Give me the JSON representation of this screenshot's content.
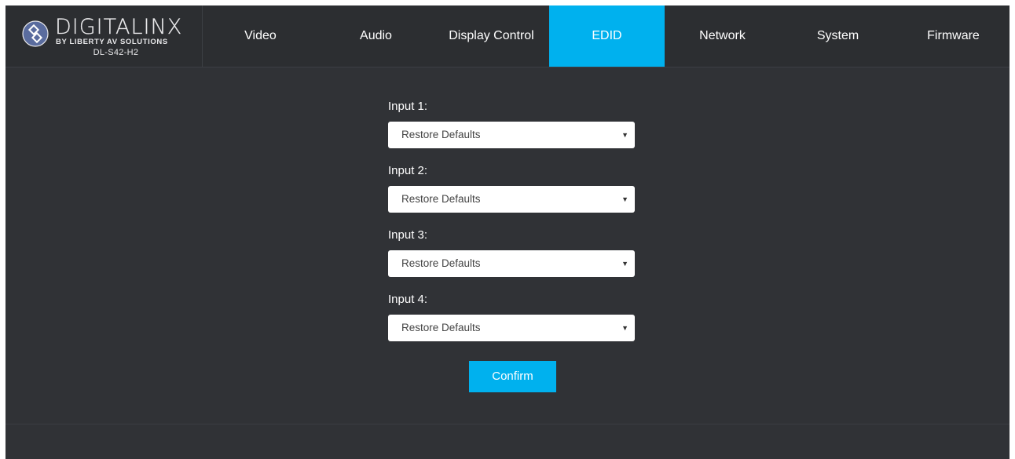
{
  "brand": {
    "name": "DIGITALINX",
    "tagline": "BY LIBERTY AV SOLUTIONS",
    "model": "DL-S42-H2",
    "logo_icon": "diamond-link-icon"
  },
  "nav": {
    "items": [
      {
        "label": "Video"
      },
      {
        "label": "Audio"
      },
      {
        "label": "Display Control"
      },
      {
        "label": "EDID"
      },
      {
        "label": "Network"
      },
      {
        "label": "System"
      },
      {
        "label": "Firmware"
      }
    ],
    "active": "EDID"
  },
  "edid": {
    "inputs": [
      {
        "label": "Input 1:",
        "value": "Restore Defaults"
      },
      {
        "label": "Input 2:",
        "value": "Restore Defaults"
      },
      {
        "label": "Input 3:",
        "value": "Restore Defaults"
      },
      {
        "label": "Input 4:",
        "value": "Restore Defaults"
      }
    ],
    "caret": "▼",
    "confirm_label": "Confirm"
  },
  "colors": {
    "accent": "#00b1ee",
    "background": "#303236",
    "header": "#2c2e31"
  }
}
